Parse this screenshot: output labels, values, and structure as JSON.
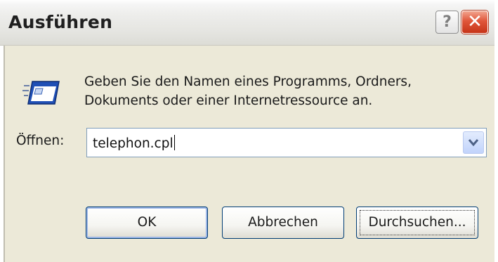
{
  "window": {
    "title": "Ausführen",
    "help_label": "?",
    "close_label": "✕"
  },
  "dialog": {
    "description_line1": "Geben Sie den Namen eines Programms, Ordners,",
    "description_line2": "Dokuments oder einer Internetressource an.",
    "open_label": "Öffnen:",
    "open_value": "telephon.cpl",
    "icon": "run-program-icon"
  },
  "buttons": {
    "ok": "OK",
    "cancel": "Abbrechen",
    "browse": "Durchsuchen..."
  },
  "colors": {
    "dialog_background": "#ece9d8",
    "button_border": "#003c74",
    "close_button": "#e0563a"
  }
}
